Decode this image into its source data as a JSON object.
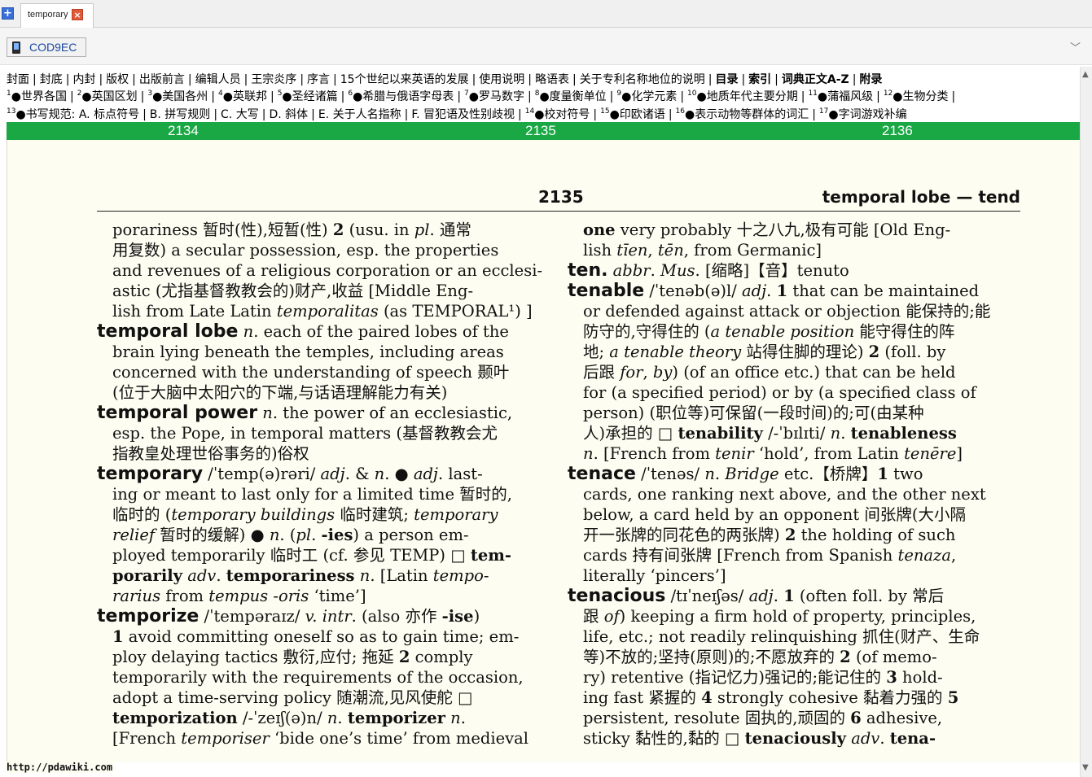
{
  "tabs": [
    {
      "label": "temporary"
    }
  ],
  "address": {
    "text": "COD9EC"
  },
  "nav": {
    "row1": [
      {
        "label": "封面"
      },
      {
        "label": "封底"
      },
      {
        "label": "内封"
      },
      {
        "label": "版权"
      },
      {
        "label": "出版前言"
      },
      {
        "label": "编辑人员"
      },
      {
        "label": "王宗炎序"
      },
      {
        "label": "序言"
      },
      {
        "label": "15个世纪以来英语的发展"
      },
      {
        "label": "使用说明"
      },
      {
        "label": "略语表"
      },
      {
        "label": "关于专利名称地位的说明"
      },
      {
        "label": "目录",
        "bold": true
      },
      {
        "label": "索引",
        "bold": true
      },
      {
        "label": "词典正文A-Z",
        "bold": true
      },
      {
        "label": "附录",
        "bold": true
      }
    ],
    "row2": [
      {
        "num": "1",
        "label": "●世界各国"
      },
      {
        "num": "2",
        "label": "●英国区划"
      },
      {
        "num": "3",
        "label": "●美国各州"
      },
      {
        "num": "4",
        "label": "●英联邦"
      },
      {
        "num": "5",
        "label": "●圣经诸篇"
      },
      {
        "num": "6",
        "label": "●希腊与俄语字母表"
      },
      {
        "num": "7",
        "label": "●罗马数字"
      },
      {
        "num": "8",
        "label": "●度量衡单位"
      },
      {
        "num": "9",
        "label": "●化学元素"
      },
      {
        "num": "10",
        "label": "●地质年代主要分期"
      },
      {
        "num": "11",
        "label": "●蒲福风级"
      },
      {
        "num": "12",
        "label": "●生物分类"
      }
    ],
    "row3": [
      {
        "num": "13",
        "label": "●书写规范: A. 标点符号"
      },
      {
        "num": "",
        "label": "B. 拼写规则"
      },
      {
        "num": "",
        "label": "C. 大写"
      },
      {
        "num": "",
        "label": "D. 斜体"
      },
      {
        "num": "",
        "label": "E. 关于人名指称"
      },
      {
        "num": "",
        "label": "F. 冒犯语及性别歧视"
      },
      {
        "num": "14",
        "label": "●校对符号"
      },
      {
        "num": "15",
        "label": "●印欧诸语"
      },
      {
        "num": "16",
        "label": "●表示动物等群体的词汇"
      },
      {
        "num": "17",
        "label": "●字词游戏补编"
      }
    ]
  },
  "pagebar": {
    "prev": "2134",
    "current": "2135",
    "next": "2136"
  },
  "page": {
    "number": "2135",
    "running_head": "temporal lobe — tend",
    "left_col": [
      {
        "ind": true,
        "runs": [
          {
            "t": "porariness 暂时(性),短暂(性) "
          },
          {
            "t": "2",
            "s": "bf"
          },
          {
            "t": " (usu. in "
          },
          {
            "t": "pl",
            "s": "it"
          },
          {
            "t": ". 通常"
          }
        ]
      },
      {
        "ind": true,
        "runs": [
          {
            "t": "用复数) a secular possession, esp. the properties"
          }
        ]
      },
      {
        "ind": true,
        "runs": [
          {
            "t": "and revenues of a religious corporation or an ecclesi-"
          }
        ]
      },
      {
        "ind": true,
        "runs": [
          {
            "t": "astic (尤指基督教教会的)财产,收益 [Middle Eng-"
          }
        ]
      },
      {
        "ind": true,
        "runs": [
          {
            "t": "lish from Late Latin "
          },
          {
            "t": "temporalitas",
            "s": "it"
          },
          {
            "t": " (as TEMPORAL¹) ]"
          }
        ]
      },
      {
        "ind": false,
        "runs": [
          {
            "t": "temporal lobe",
            "s": "hw"
          },
          {
            "t": " "
          },
          {
            "t": "n",
            "s": "it"
          },
          {
            "t": ". each of the paired lobes of the"
          }
        ]
      },
      {
        "ind": true,
        "runs": [
          {
            "t": "brain lying beneath the temples, including areas"
          }
        ]
      },
      {
        "ind": true,
        "runs": [
          {
            "t": "concerned with the understanding of speech 颞叶"
          }
        ]
      },
      {
        "ind": true,
        "runs": [
          {
            "t": "(位于大脑中太阳穴的下端,与话语理解能力有关)"
          }
        ]
      },
      {
        "ind": false,
        "runs": [
          {
            "t": "temporal power",
            "s": "hw"
          },
          {
            "t": " "
          },
          {
            "t": "n",
            "s": "it"
          },
          {
            "t": ". the power of an ecclesiastic,"
          }
        ]
      },
      {
        "ind": true,
        "runs": [
          {
            "t": "esp. the Pope, in temporal matters (基督教教会尤"
          }
        ]
      },
      {
        "ind": true,
        "runs": [
          {
            "t": "指教皇处理世俗事务的)俗权"
          }
        ]
      },
      {
        "ind": false,
        "runs": [
          {
            "t": "temporary",
            "s": "hw"
          },
          {
            "t": " /ˈtemp(ə)rəri/ "
          },
          {
            "t": "adj",
            "s": "it"
          },
          {
            "t": ". & "
          },
          {
            "t": "n",
            "s": "it"
          },
          {
            "t": ". ● "
          },
          {
            "t": "adj",
            "s": "it"
          },
          {
            "t": ". last-"
          }
        ]
      },
      {
        "ind": true,
        "runs": [
          {
            "t": "ing or meant to last only for a limited time 暂时的,"
          }
        ]
      },
      {
        "ind": true,
        "runs": [
          {
            "t": "临时的 ("
          },
          {
            "t": "temporary buildings",
            "s": "it"
          },
          {
            "t": " 临时建筑; "
          },
          {
            "t": "temporary",
            "s": "it"
          }
        ]
      },
      {
        "ind": true,
        "runs": [
          {
            "t": "relief",
            "s": "it"
          },
          {
            "t": " 暂时的缓解) ● "
          },
          {
            "t": "n",
            "s": "it"
          },
          {
            "t": ". ("
          },
          {
            "t": "pl",
            "s": "it"
          },
          {
            "t": ". "
          },
          {
            "t": "-ies",
            "s": "bf"
          },
          {
            "t": ") a person em-"
          }
        ]
      },
      {
        "ind": true,
        "runs": [
          {
            "t": "ployed temporarily 临时工 (cf. 参见 TEMP) □ "
          },
          {
            "t": "tem-",
            "s": "bf"
          }
        ]
      },
      {
        "ind": true,
        "runs": [
          {
            "t": "porarily",
            "s": "bf"
          },
          {
            "t": " "
          },
          {
            "t": "adv",
            "s": "it"
          },
          {
            "t": ". "
          },
          {
            "t": "temporariness",
            "s": "bf"
          },
          {
            "t": " "
          },
          {
            "t": "n",
            "s": "it"
          },
          {
            "t": ". [Latin "
          },
          {
            "t": "tempo-",
            "s": "it"
          }
        ]
      },
      {
        "ind": true,
        "runs": [
          {
            "t": "rarius",
            "s": "it"
          },
          {
            "t": " from "
          },
          {
            "t": "tempus -oris",
            "s": "it"
          },
          {
            "t": " ‘time’]"
          }
        ]
      },
      {
        "ind": false,
        "runs": [
          {
            "t": "temporize",
            "s": "hw"
          },
          {
            "t": " /ˈtempəraɪz/ "
          },
          {
            "t": "v. intr",
            "s": "it"
          },
          {
            "t": ". (also 亦作 "
          },
          {
            "t": "-ise",
            "s": "bf"
          },
          {
            "t": ")"
          }
        ]
      },
      {
        "ind": true,
        "runs": [
          {
            "t": "1",
            "s": "bf"
          },
          {
            "t": " avoid committing oneself so as to gain time; em-"
          }
        ]
      },
      {
        "ind": true,
        "runs": [
          {
            "t": "ploy delaying tactics 敷衍,应付; 拖延 "
          },
          {
            "t": "2",
            "s": "bf"
          },
          {
            "t": " comply"
          }
        ]
      },
      {
        "ind": true,
        "runs": [
          {
            "t": "temporarily with the requirements of the occasion,"
          }
        ]
      },
      {
        "ind": true,
        "runs": [
          {
            "t": "adopt a time-serving policy 随潮流,见风使舵 □"
          }
        ]
      },
      {
        "ind": true,
        "runs": [
          {
            "t": "temporization",
            "s": "bf"
          },
          {
            "t": " /-ˈzeɪʃ(ə)n/ "
          },
          {
            "t": "n",
            "s": "it"
          },
          {
            "t": ". "
          },
          {
            "t": "temporizer",
            "s": "bf"
          },
          {
            "t": " "
          },
          {
            "t": "n",
            "s": "it"
          },
          {
            "t": "."
          }
        ]
      },
      {
        "ind": true,
        "runs": [
          {
            "t": "[French "
          },
          {
            "t": "temporiser",
            "s": "it"
          },
          {
            "t": " ‘bide one’s time’ from medieval"
          }
        ]
      }
    ],
    "right_col": [
      {
        "ind": true,
        "runs": [
          {
            "t": "one",
            "s": "bf"
          },
          {
            "t": " very probably 十之八九,极有可能 [Old Eng-"
          }
        ]
      },
      {
        "ind": true,
        "runs": [
          {
            "t": "lish "
          },
          {
            "t": "tīen",
            "s": "it"
          },
          {
            "t": ", "
          },
          {
            "t": "tēn",
            "s": "it"
          },
          {
            "t": ", from Germanic]"
          }
        ]
      },
      {
        "ind": false,
        "runs": [
          {
            "t": "ten.",
            "s": "hw"
          },
          {
            "t": " "
          },
          {
            "t": "abbr",
            "s": "it"
          },
          {
            "t": ". "
          },
          {
            "t": "Mus",
            "s": "it"
          },
          {
            "t": ". [缩略]【音】tenuto"
          }
        ]
      },
      {
        "ind": false,
        "runs": [
          {
            "t": "tenable",
            "s": "hw"
          },
          {
            "t": " /ˈtenəb(ə)l/ "
          },
          {
            "t": "adj",
            "s": "it"
          },
          {
            "t": ". "
          },
          {
            "t": "1",
            "s": "bf"
          },
          {
            "t": " that can be maintained"
          }
        ]
      },
      {
        "ind": true,
        "runs": [
          {
            "t": "or defended against attack or objection 能保持的;能"
          }
        ]
      },
      {
        "ind": true,
        "runs": [
          {
            "t": "防守的,守得住的 ("
          },
          {
            "t": "a tenable position",
            "s": "it"
          },
          {
            "t": " 能守得住的阵"
          }
        ]
      },
      {
        "ind": true,
        "runs": [
          {
            "t": "地; "
          },
          {
            "t": "a tenable theory",
            "s": "it"
          },
          {
            "t": " 站得住脚的理论) "
          },
          {
            "t": "2",
            "s": "bf"
          },
          {
            "t": " (foll. by"
          }
        ]
      },
      {
        "ind": true,
        "runs": [
          {
            "t": "后跟 "
          },
          {
            "t": "for",
            "s": "it"
          },
          {
            "t": ", "
          },
          {
            "t": "by",
            "s": "it"
          },
          {
            "t": ") (of an office etc.) that can be held"
          }
        ]
      },
      {
        "ind": true,
        "runs": [
          {
            "t": "for (a specified period) or by (a specified class of"
          }
        ]
      },
      {
        "ind": true,
        "runs": [
          {
            "t": "person) (职位等)可保留(一段时间)的;可(由某种"
          }
        ]
      },
      {
        "ind": true,
        "runs": [
          {
            "t": "人)承担的 □ "
          },
          {
            "t": "tenability",
            "s": "bf"
          },
          {
            "t": " /-ˈbɪlɪti/ "
          },
          {
            "t": "n",
            "s": "it"
          },
          {
            "t": ". "
          },
          {
            "t": "tenableness",
            "s": "bf"
          }
        ]
      },
      {
        "ind": true,
        "runs": [
          {
            "t": "n",
            "s": "it"
          },
          {
            "t": ". [French from "
          },
          {
            "t": "tenir",
            "s": "it"
          },
          {
            "t": " ‘hold’, from Latin "
          },
          {
            "t": "tenēre",
            "s": "it"
          },
          {
            "t": "]"
          }
        ]
      },
      {
        "ind": false,
        "runs": [
          {
            "t": "tenace",
            "s": "hw"
          },
          {
            "t": " /ˈtenəs/ "
          },
          {
            "t": "n",
            "s": "it"
          },
          {
            "t": ". "
          },
          {
            "t": "Bridge",
            "s": "it"
          },
          {
            "t": " etc.【桥牌】"
          },
          {
            "t": "1",
            "s": "bf"
          },
          {
            "t": " two"
          }
        ]
      },
      {
        "ind": true,
        "runs": [
          {
            "t": "cards, one ranking next above, and the other next"
          }
        ]
      },
      {
        "ind": true,
        "runs": [
          {
            "t": "below, a card held by an opponent 间张牌(大小隔"
          }
        ]
      },
      {
        "ind": true,
        "runs": [
          {
            "t": "开一张牌的同花色的两张牌) "
          },
          {
            "t": "2",
            "s": "bf"
          },
          {
            "t": " the holding of such"
          }
        ]
      },
      {
        "ind": true,
        "runs": [
          {
            "t": "cards 持有间张牌 [French from Spanish "
          },
          {
            "t": "tenaza",
            "s": "it"
          },
          {
            "t": ","
          }
        ]
      },
      {
        "ind": true,
        "runs": [
          {
            "t": "literally ‘pincers’]"
          }
        ]
      },
      {
        "ind": false,
        "runs": [
          {
            "t": "tenacious",
            "s": "hw"
          },
          {
            "t": " /tɪˈneɪʃəs/ "
          },
          {
            "t": "adj",
            "s": "it"
          },
          {
            "t": ". "
          },
          {
            "t": "1",
            "s": "bf"
          },
          {
            "t": " (often foll. by 常后"
          }
        ]
      },
      {
        "ind": true,
        "runs": [
          {
            "t": "跟 "
          },
          {
            "t": "of",
            "s": "it"
          },
          {
            "t": ") keeping a firm hold of property, principles,"
          }
        ]
      },
      {
        "ind": true,
        "runs": [
          {
            "t": "life, etc.; not readily relinquishing 抓住(财产、生命"
          }
        ]
      },
      {
        "ind": true,
        "runs": [
          {
            "t": "等)不放的;坚持(原则)的;不愿放弃的 "
          },
          {
            "t": "2",
            "s": "bf"
          },
          {
            "t": " (of memo-"
          }
        ]
      },
      {
        "ind": true,
        "runs": [
          {
            "t": "ry) retentive (指记忆力)强记的;能记住的 "
          },
          {
            "t": "3",
            "s": "bf"
          },
          {
            "t": " hold-"
          }
        ]
      },
      {
        "ind": true,
        "runs": [
          {
            "t": "ing fast 紧握的 "
          },
          {
            "t": "4",
            "s": "bf"
          },
          {
            "t": " strongly cohesive 黏着力强的 "
          },
          {
            "t": "5",
            "s": "bf"
          }
        ]
      },
      {
        "ind": true,
        "runs": [
          {
            "t": "persistent, resolute 固执的,顽固的 "
          },
          {
            "t": "6",
            "s": "bf"
          },
          {
            "t": " adhesive,"
          }
        ]
      },
      {
        "ind": true,
        "runs": [
          {
            "t": "sticky 黏性的,黏的 □ "
          },
          {
            "t": "tenaciously",
            "s": "bf"
          },
          {
            "t": " "
          },
          {
            "t": "adv",
            "s": "it"
          },
          {
            "t": ". "
          },
          {
            "t": "tena-",
            "s": "bf"
          }
        ]
      }
    ]
  },
  "watermark": "http://pdawiki.com"
}
